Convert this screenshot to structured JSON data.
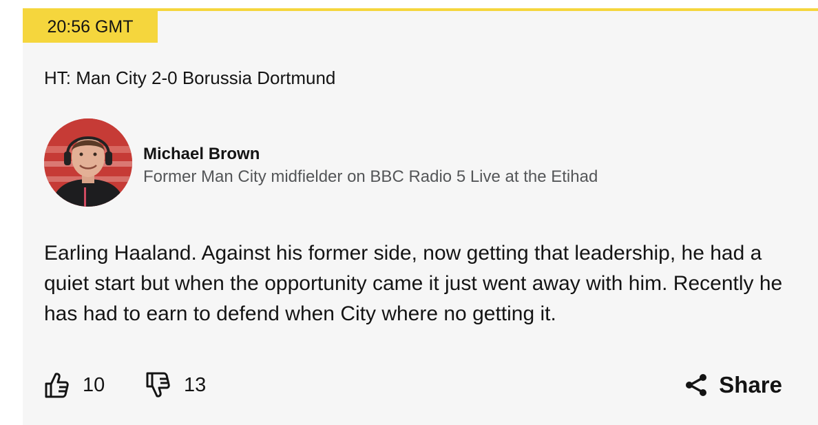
{
  "post": {
    "time": "20:56 GMT",
    "headline": "HT: Man City 2-0 Borussia Dortmund",
    "author": {
      "name": "Michael Brown",
      "role": "Former Man City midfielder on BBC Radio 5 Live at the Etihad"
    },
    "body": "Earling Haaland. Against his former side, now getting that leadership, he had a quiet start but when the opportunity came it just went away with him. Recently he has had to earn to defend when City where no getting it.",
    "reactions": {
      "likes": "10",
      "dislikes": "13"
    },
    "share_label": "Share"
  },
  "colors": {
    "accent": "#f5d63d",
    "card_bg": "#f6f6f6",
    "text": "#141414",
    "secondary_text": "#545658"
  },
  "icons": {
    "like": "thumbs-up-icon",
    "dislike": "thumbs-down-icon",
    "share": "share-icon"
  }
}
